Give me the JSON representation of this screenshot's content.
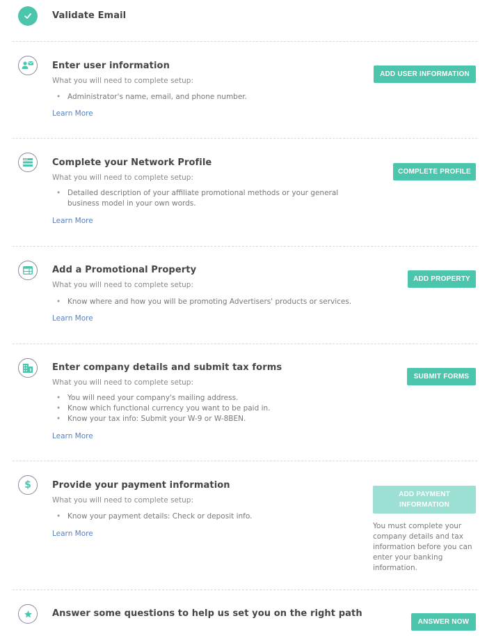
{
  "colors": {
    "accent": "#4bc5ac",
    "accent_disabled": "#9be0d2",
    "link": "#5580c0"
  },
  "steps": [
    {
      "title": "Validate Email",
      "icon": "check-icon",
      "completed": true
    },
    {
      "title": "Enter user information",
      "icon": "user-contact-icon",
      "subtitle": "What you will need to complete setup:",
      "bullets": [
        "Administrator's name, email, and phone number."
      ],
      "learn_more": "Learn More",
      "button": "ADD USER INFORMATION"
    },
    {
      "title": "Complete your Network Profile",
      "icon": "profile-card-icon",
      "subtitle": "What you will need to complete setup:",
      "bullets": [
        "Detailed description of your affiliate promotional methods or your general business model in your own words."
      ],
      "learn_more": "Learn More",
      "button": "COMPLETE PROFILE"
    },
    {
      "title": "Add a Promotional Property",
      "icon": "browser-window-icon",
      "subtitle": "What you will need to complete setup:",
      "bullets": [
        "Know where and how you will be promoting Advertisers' products or services."
      ],
      "learn_more": "Learn More",
      "button": "ADD PROPERTY"
    },
    {
      "title": "Enter company details and submit tax forms",
      "icon": "building-icon",
      "subtitle": "What you will need to complete setup:",
      "bullets": [
        "You will need your company's mailing address.",
        "Know which functional currency you want to be paid in.",
        "Know your tax info: Submit your W-9 or W-8BEN."
      ],
      "learn_more": "Learn More",
      "button": "SUBMIT FORMS"
    },
    {
      "title": "Provide your payment information",
      "icon": "dollar-icon",
      "subtitle": "What you will need to complete setup:",
      "bullets": [
        "Know your payment details: Check or deposit info."
      ],
      "learn_more": "Learn More",
      "button": "ADD PAYMENT INFORMATION",
      "button_disabled": true,
      "note": "You must complete your company details and tax information before you can enter your banking information."
    },
    {
      "title": "Answer some questions to help us set you on the right path",
      "icon": "star-icon",
      "button": "ANSWER NOW"
    }
  ]
}
